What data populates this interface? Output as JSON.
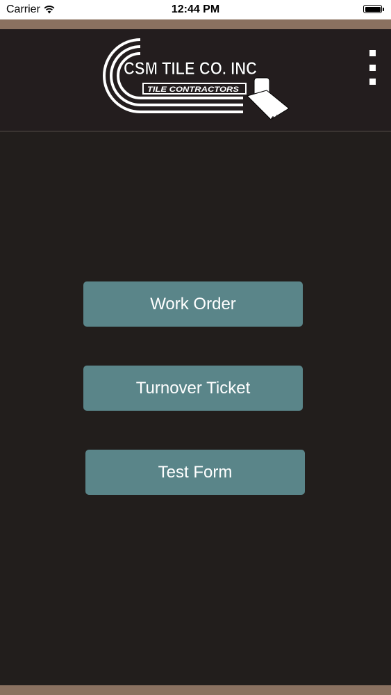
{
  "status_bar": {
    "carrier": "Carrier",
    "time": "12:44 PM",
    "icons": [
      "wifi-icon",
      "battery-icon"
    ]
  },
  "header": {
    "logo": {
      "company_name": "CSM TILE CO. INC",
      "tagline": "TILE CONTRACTORS",
      "icon": "trowel-icon"
    },
    "menu_icon": "kebab-menu-icon"
  },
  "buttons": [
    {
      "label": "Work Order"
    },
    {
      "label": "Turnover Ticket"
    },
    {
      "label": "Test Form"
    }
  ],
  "colors": {
    "background": "#221e1c",
    "header_background": "#231d1e",
    "accent_stripe": "#8a7160",
    "button": "#5a8589",
    "button_text": "#ffffff"
  }
}
